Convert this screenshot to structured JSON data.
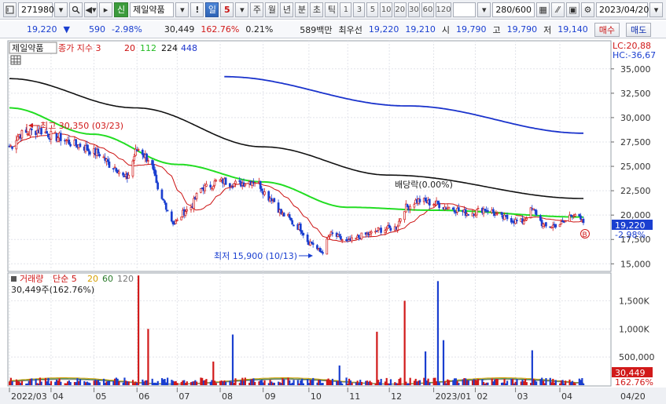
{
  "toolbar": {
    "code": "271980",
    "market_badge": "신",
    "stock_name": "제일약품",
    "period_day": "일",
    "period_num": "5",
    "period_week": "주",
    "period_month": "월",
    "period_year": "년",
    "period_minute": "분",
    "period_sec": "초",
    "period_tick": "틱",
    "intervals": [
      "1",
      "3",
      "5",
      "10",
      "20",
      "30",
      "60",
      "120"
    ],
    "count": "280/600",
    "date": "2023/04/20"
  },
  "quote": {
    "price": "19,220",
    "change": "590",
    "change_rate": "-2.98%",
    "volume": "30,449",
    "volume_rate": "162.76%",
    "turnover": "0.21%",
    "amount": "589백만",
    "best_label": "최우선",
    "best_ask": "19,220",
    "best_bid": "19,210",
    "open_label": "시",
    "open": "19,790",
    "high_label": "고",
    "high": "19,790",
    "low_label": "저",
    "low": "19,140",
    "buy_label": "매수",
    "sell_label": "매도"
  },
  "price_panel": {
    "name_box": "제일약품",
    "legend_prefix": "종가 지수 3",
    "ma": [
      "20",
      "112",
      "224",
      "448"
    ],
    "lc": "LC:20,88",
    "hc": "HC:-36,67",
    "high_note": "최고 30,350 (03/23)",
    "low_note": "최저 15,900 (10/13)",
    "div_note": "배당락(0.00%)",
    "current_price": "19,220",
    "current_rate": "-2.98%",
    "b_marker": "B"
  },
  "volume_panel": {
    "title": "거래량",
    "ma_prefix": "단순 5",
    "ma": [
      "20",
      "60",
      "120"
    ],
    "info": "30,449주(162.76%)",
    "current": "30,449",
    "current_rate": "162.76%"
  },
  "colors": {
    "up": "#d11a1a",
    "down": "#1a3fd0",
    "ma20": "#cc1111",
    "ma112": "#22dd22",
    "ma224": "#111111",
    "ma448": "#1a33cc"
  },
  "chart_data": {
    "type": "candlestick",
    "price_axis": {
      "ticks": [
        15000,
        17500,
        20000,
        22500,
        25000,
        27500,
        30000,
        32500,
        35000
      ],
      "range": [
        14300,
        37800
      ]
    },
    "volume_axis": {
      "ticks": [
        500000,
        1000000,
        1500000
      ],
      "tick_labels": [
        "500,000",
        "1,000K",
        "1,500K"
      ],
      "range": [
        0,
        1980000
      ]
    },
    "x_labels": [
      "2022/03",
      "04",
      "05",
      "06",
      "07",
      "08",
      "09",
      "10",
      "11",
      "12",
      "2023/01",
      "02",
      "03",
      "04"
    ],
    "x_last_label": "04/20",
    "close_anchors": [
      {
        "date": "2022/03/02",
        "value": 27000
      },
      {
        "date": "2022/03/10",
        "value": 28300
      },
      {
        "date": "2022/03/23",
        "value": 28700
      },
      {
        "date": "2022/04/05",
        "value": 28000
      },
      {
        "date": "2022/04/20",
        "value": 27200
      },
      {
        "date": "2022/05/04",
        "value": 26400
      },
      {
        "date": "2022/05/16",
        "value": 25000
      },
      {
        "date": "2022/05/25",
        "value": 23800
      },
      {
        "date": "2022/06/03",
        "value": 26800
      },
      {
        "date": "2022/06/10",
        "value": 25800
      },
      {
        "date": "2022/06/20",
        "value": 21500
      },
      {
        "date": "2022/06/29",
        "value": 19200
      },
      {
        "date": "2022/07/08",
        "value": 20500
      },
      {
        "date": "2022/07/20",
        "value": 22800
      },
      {
        "date": "2022/08/01",
        "value": 23500
      },
      {
        "date": "2022/08/12",
        "value": 23200
      },
      {
        "date": "2022/08/26",
        "value": 23500
      },
      {
        "date": "2022/09/06",
        "value": 21800
      },
      {
        "date": "2022/09/16",
        "value": 20000
      },
      {
        "date": "2022/09/26",
        "value": 18800
      },
      {
        "date": "2022/10/05",
        "value": 17200
      },
      {
        "date": "2022/10/13",
        "value": 16200
      },
      {
        "date": "2022/10/20",
        "value": 18000
      },
      {
        "date": "2022/11/01",
        "value": 17300
      },
      {
        "date": "2022/11/15",
        "value": 18000
      },
      {
        "date": "2022/11/25",
        "value": 18500
      },
      {
        "date": "2022/12/05",
        "value": 18700
      },
      {
        "date": "2022/12/13",
        "value": 20800
      },
      {
        "date": "2022/12/22",
        "value": 21500
      },
      {
        "date": "2023/01/02",
        "value": 21200
      },
      {
        "date": "2023/01/12",
        "value": 20800
      },
      {
        "date": "2023/01/27",
        "value": 20200
      },
      {
        "date": "2023/02/08",
        "value": 20600
      },
      {
        "date": "2023/02/22",
        "value": 19700
      },
      {
        "date": "2023/03/06",
        "value": 19300
      },
      {
        "date": "2023/03/14",
        "value": 20500
      },
      {
        "date": "2023/03/24",
        "value": 18800
      },
      {
        "date": "2023/04/04",
        "value": 19100
      },
      {
        "date": "2023/04/13",
        "value": 20200
      },
      {
        "date": "2023/04/20",
        "value": 19220
      }
    ],
    "ma_anchors": {
      "ma448": [
        {
          "date": "2022/08/04",
          "value": 34200
        },
        {
          "date": "2022/12/14",
          "value": 31200
        },
        {
          "date": "2023/04/20",
          "value": 28400
        }
      ],
      "ma224": [
        {
          "date": "2022/03/02",
          "value": 34000
        },
        {
          "date": "2022/06/01",
          "value": 31000
        },
        {
          "date": "2022/09/01",
          "value": 27000
        },
        {
          "date": "2022/12/01",
          "value": 24100
        },
        {
          "date": "2023/04/20",
          "value": 21700
        }
      ],
      "ma112": [
        {
          "date": "2022/03/02",
          "value": 31000
        },
        {
          "date": "2022/05/01",
          "value": 28300
        },
        {
          "date": "2022/07/01",
          "value": 25200
        },
        {
          "date": "2022/09/01",
          "value": 23400
        },
        {
          "date": "2022/11/01",
          "value": 20800
        },
        {
          "date": "2023/01/01",
          "value": 20500
        },
        {
          "date": "2023/04/20",
          "value": 19800
        }
      ]
    },
    "volume_spikes": [
      {
        "date": "2022/06/03",
        "value": 1950000
      },
      {
        "date": "2022/06/10",
        "value": 1000000
      },
      {
        "date": "2022/07/27",
        "value": 420000
      },
      {
        "date": "2022/08/10",
        "value": 900000
      },
      {
        "date": "2022/10/26",
        "value": 350000
      },
      {
        "date": "2022/11/22",
        "value": 950000
      },
      {
        "date": "2022/12/12",
        "value": 1500000
      },
      {
        "date": "2022/12/27",
        "value": 600000
      },
      {
        "date": "2023/01/05",
        "value": 1850000
      },
      {
        "date": "2023/01/09",
        "value": 800000
      },
      {
        "date": "2023/03/14",
        "value": 620000
      }
    ],
    "volume_baseline": 90000,
    "volume_last": 30449
  }
}
